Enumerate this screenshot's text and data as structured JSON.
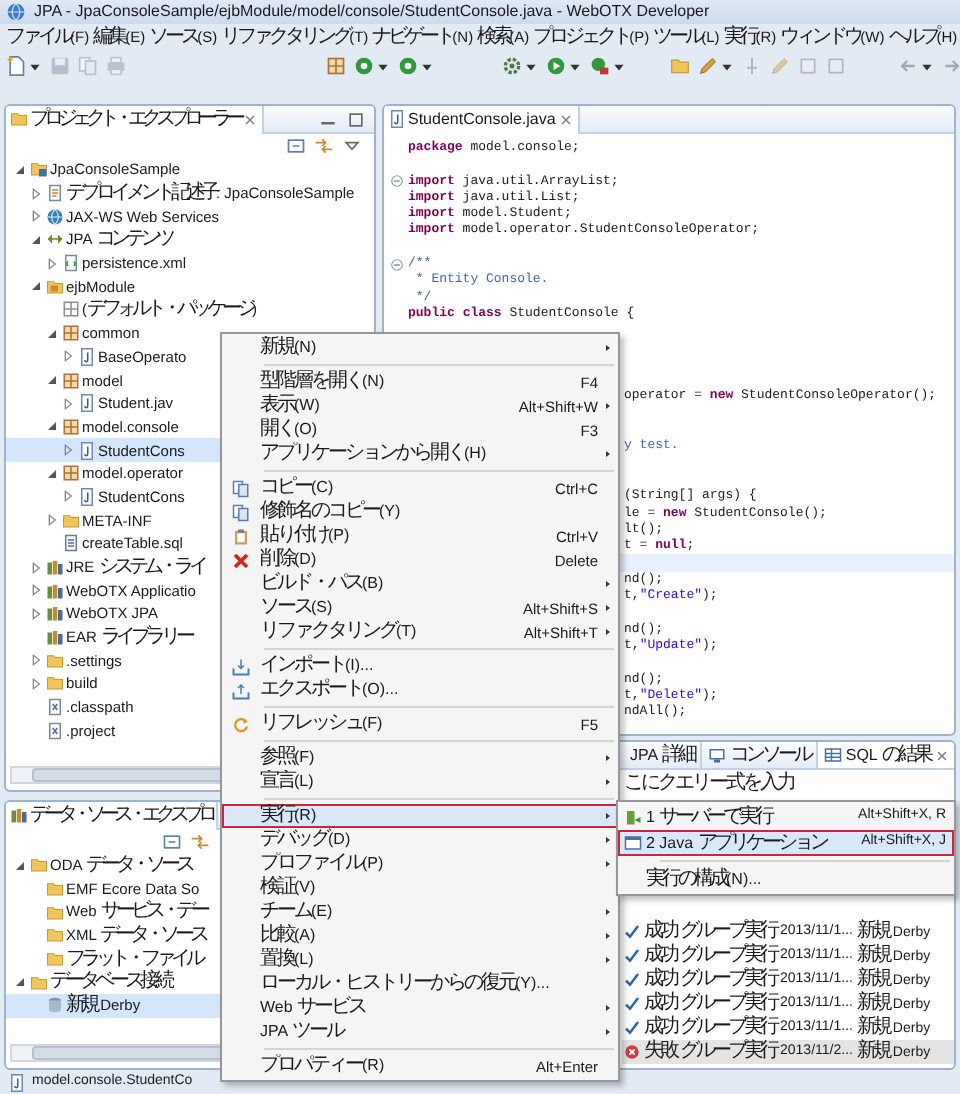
{
  "window": {
    "title": "JPA - JpaConsoleSample/ejbModule/model/console/StudentConsole.java - WebOTX Developer"
  },
  "menu_bar": [
    "ファイル(F)",
    "編集(E)",
    "ソース(S)",
    "リファクタリング(T)",
    "ナビゲート(N)",
    "検索(A)",
    "プロジェクト(P)",
    "ツール(L)",
    "実行(R)",
    "ウィンドウ(W)",
    "ヘルプ(H)"
  ],
  "project_explorer": {
    "title": "プロジェクト・エクスプローラー",
    "tree": [
      {
        "label": "JpaConsoleSample",
        "kind": "project",
        "expanded": true,
        "selected": false,
        "children": [
          {
            "label": "デプロイメント記述子: JpaConsoleSample",
            "kind": "descriptor",
            "expanded": false,
            "selected": false
          },
          {
            "label": "JAX-WS Web Services",
            "kind": "webservices",
            "expanded": false,
            "selected": false
          },
          {
            "label": "JPA コンテンツ",
            "kind": "jpa",
            "expanded": true,
            "selected": false,
            "children": [
              {
                "label": "persistence.xml",
                "kind": "xml",
                "expanded": false,
                "selected": false
              }
            ]
          },
          {
            "label": "ejbModule",
            "kind": "source-folder",
            "expanded": true,
            "selected": false,
            "children": [
              {
                "label": "(デフォルト・パッケージ)",
                "kind": "package-empty",
                "selected": false
              },
              {
                "label": "common",
                "kind": "package",
                "expanded": true,
                "selected": false,
                "children": [
                  {
                    "label": "BaseOperato",
                    "kind": "java",
                    "expanded": false,
                    "selected": false
                  }
                ]
              },
              {
                "label": "model",
                "kind": "package",
                "expanded": true,
                "selected": false,
                "children": [
                  {
                    "label": "Student.jav",
                    "kind": "java",
                    "expanded": false,
                    "selected": false
                  }
                ]
              },
              {
                "label": "model.console",
                "kind": "package",
                "expanded": true,
                "selected": false,
                "children": [
                  {
                    "label": "StudentCons",
                    "kind": "java",
                    "expanded": false,
                    "selected": true
                  }
                ]
              },
              {
                "label": "model.operator",
                "kind": "package",
                "expanded": true,
                "selected": false,
                "children": [
                  {
                    "label": "StudentCons",
                    "kind": "java",
                    "expanded": false,
                    "selected": false
                  }
                ]
              },
              {
                "label": "META-INF",
                "kind": "folder",
                "expanded": false,
                "selected": false
              },
              {
                "label": "createTable.sql",
                "kind": "sql",
                "selected": false
              }
            ]
          },
          {
            "label": "JRE システム・ライ",
            "kind": "library",
            "expanded": false,
            "selected": false
          },
          {
            "label": "WebOTX Applicatio",
            "kind": "library",
            "expanded": false,
            "selected": false
          },
          {
            "label": "WebOTX JPA",
            "kind": "library",
            "expanded": false,
            "selected": false
          },
          {
            "label": "EAR ライブラリー",
            "kind": "library",
            "selected": false
          },
          {
            "label": ".settings",
            "kind": "folder",
            "expanded": false,
            "selected": false
          },
          {
            "label": "build",
            "kind": "folder",
            "expanded": false,
            "selected": false
          },
          {
            "label": ".classpath",
            "kind": "file",
            "selected": false
          },
          {
            "label": ".project",
            "kind": "file",
            "selected": false
          }
        ]
      }
    ]
  },
  "data_source_explorer": {
    "title": "データ・ソース・エクスプロ",
    "tree": [
      {
        "label": "ODA データ・ソース",
        "kind": "folder",
        "expanded": true,
        "selected": false,
        "children": [
          {
            "label": "EMF Ecore Data So",
            "kind": "folder",
            "selected": false
          },
          {
            "label": "Web サービス・デー",
            "kind": "folder",
            "selected": false
          },
          {
            "label": "XML データ・ソース",
            "kind": "folder",
            "selected": false
          },
          {
            "label": "フラット・ファイル",
            "kind": "folder",
            "selected": false
          }
        ]
      },
      {
        "label": "データベース接続",
        "kind": "folder",
        "expanded": true,
        "selected": false,
        "children": [
          {
            "label": "新規 Derby",
            "kind": "database",
            "selected": true
          }
        ]
      }
    ]
  },
  "editor": {
    "tab": "StudentConsole.java",
    "lines": [
      {
        "kind": "code",
        "text": "package model.console;",
        "current": false
      },
      {
        "kind": "blank",
        "current": false
      },
      {
        "kind": "code",
        "text": "import java.util.ArrayList;",
        "foldable": true,
        "current": false
      },
      {
        "kind": "code",
        "text": "import java.util.List;",
        "current": false
      },
      {
        "kind": "code",
        "text": "import model.Student;",
        "current": false
      },
      {
        "kind": "code",
        "text": "import model.operator.StudentConsoleOperator;",
        "current": false
      },
      {
        "kind": "blank",
        "current": false
      },
      {
        "kind": "comment",
        "text": "/**",
        "foldable": true,
        "current": false
      },
      {
        "kind": "comment",
        "text": " * Entity Console.",
        "current": false
      },
      {
        "kind": "comment",
        "text": " */",
        "current": false
      },
      {
        "kind": "code",
        "text": "public class StudentConsole {",
        "current": false
      },
      {
        "kind": "blank",
        "current": false
      },
      {
        "kind": "blank",
        "current": false
      },
      {
        "kind": "blank",
        "current": false
      },
      {
        "kind": "blank",
        "current": false
      },
      {
        "kind": "code",
        "text": "operator = new StudentConsoleOperator();",
        "clipped": true,
        "current": false
      },
      {
        "kind": "blank",
        "current": false
      },
      {
        "kind": "blank",
        "current": false
      },
      {
        "kind": "comment",
        "text": "y test.",
        "clipped": true,
        "current": false
      },
      {
        "kind": "blank",
        "current": false
      },
      {
        "kind": "blank",
        "current": false
      },
      {
        "kind": "code",
        "text": "(String[] args) {",
        "clipped": true,
        "current": false
      },
      {
        "kind": "code",
        "text": "le = new StudentConsole();",
        "clipped": true,
        "current": false
      },
      {
        "kind": "code",
        "text": "lt();",
        "clipped": true,
        "current": false
      },
      {
        "kind": "code",
        "text": "t = null;",
        "clipped": true,
        "current": false
      },
      {
        "kind": "blank",
        "current": true
      },
      {
        "kind": "code",
        "text": "nd();",
        "clipped": true,
        "current": false
      },
      {
        "kind": "code",
        "text": "t,\"Create\");",
        "clipped": true,
        "current": false
      },
      {
        "kind": "blank",
        "current": false
      },
      {
        "kind": "code",
        "text": "nd();",
        "clipped": true,
        "current": false
      },
      {
        "kind": "code",
        "text": "t,\"Update\");",
        "clipped": true,
        "current": false
      },
      {
        "kind": "blank",
        "current": false
      },
      {
        "kind": "code",
        "text": "nd();",
        "clipped": true,
        "current": false
      },
      {
        "kind": "code",
        "text": "t,\"Delete\");",
        "clipped": true,
        "current": false
      },
      {
        "kind": "code",
        "text": "ndAll();",
        "clipped": true,
        "current": false
      }
    ]
  },
  "bottom_panel": {
    "tabs": [
      {
        "label": "JPA 詳細",
        "kind": "plain",
        "selected": false
      },
      {
        "label": "コンソール",
        "kind": "console",
        "selected": false
      },
      {
        "label": "SQL の結果",
        "kind": "sql",
        "selected": true
      }
    ],
    "query_text": "こにクエリー式を入力",
    "rows": [
      {
        "status": "成功",
        "failed": false,
        "type": "グループ実行",
        "date": "2013/11/1...",
        "connection": "新規 Derby",
        "selected": false
      },
      {
        "status": "成功",
        "failed": false,
        "type": "グループ実行",
        "date": "2013/11/1...",
        "connection": "新規 Derby",
        "selected": false
      },
      {
        "status": "成功",
        "failed": false,
        "type": "グループ実行",
        "date": "2013/11/1...",
        "connection": "新規 Derby",
        "selected": false
      },
      {
        "status": "成功",
        "failed": false,
        "type": "グループ実行",
        "date": "2013/11/1...",
        "connection": "新規 Derby",
        "selected": false
      },
      {
        "status": "成功",
        "failed": false,
        "type": "グループ実行",
        "date": "2013/11/1...",
        "connection": "新規 Derby",
        "selected": false
      },
      {
        "status": "失敗",
        "failed": true,
        "type": "グループ実行",
        "date": "2013/11/2...",
        "connection": "新規 Derby",
        "selected": true
      }
    ]
  },
  "status_bar": "model.console.StudentCo",
  "context_menu": {
    "items": [
      {
        "kind": "item",
        "label": "新規(N)",
        "submenu": true,
        "selected": false
      },
      {
        "kind": "separator"
      },
      {
        "kind": "item",
        "label": "型階層を開く(N)",
        "shortcut": "F4",
        "submenu": false,
        "selected": false
      },
      {
        "kind": "item",
        "label": "表示(W)",
        "shortcut": "Alt+Shift+W",
        "submenu": true,
        "selected": false
      },
      {
        "kind": "item",
        "label": "開く(O)",
        "shortcut": "F3",
        "submenu": false,
        "selected": false
      },
      {
        "kind": "item",
        "label": "アプリケーションから開く(H)",
        "submenu": true,
        "selected": false
      },
      {
        "kind": "separator"
      },
      {
        "kind": "copy",
        "label": "コピー(C)",
        "shortcut": "Ctrl+C",
        "submenu": false,
        "selected": false
      },
      {
        "kind": "copy",
        "label": "修飾名のコピー(Y)",
        "submenu": false,
        "selected": false
      },
      {
        "kind": "paste",
        "label": "貼り付け(P)",
        "shortcut": "Ctrl+V",
        "submenu": false,
        "selected": false
      },
      {
        "kind": "delete",
        "label": "削除(D)",
        "shortcut": "Delete",
        "submenu": false,
        "selected": false
      },
      {
        "kind": "item",
        "label": "ビルド・パス(B)",
        "submenu": true,
        "selected": false
      },
      {
        "kind": "item",
        "label": "ソース(S)",
        "shortcut": "Alt+Shift+S",
        "submenu": true,
        "selected": false
      },
      {
        "kind": "item",
        "label": "リファクタリング(T)",
        "shortcut": "Alt+Shift+T",
        "submenu": true,
        "selected": false
      },
      {
        "kind": "separator"
      },
      {
        "kind": "import",
        "label": "インポート(I)...",
        "submenu": false,
        "selected": false
      },
      {
        "kind": "export",
        "label": "エクスポート(O)...",
        "submenu": false,
        "selected": false
      },
      {
        "kind": "separator"
      },
      {
        "kind": "refresh",
        "label": "リフレッシュ(F)",
        "shortcut": "F5",
        "submenu": false,
        "selected": false
      },
      {
        "kind": "separator"
      },
      {
        "kind": "item",
        "label": "参照(F)",
        "submenu": true,
        "selected": false
      },
      {
        "kind": "item",
        "label": "宣言(L)",
        "submenu": true,
        "selected": false
      },
      {
        "kind": "separator"
      },
      {
        "kind": "item",
        "label": "実行(R)",
        "submenu": true,
        "selected": true
      },
      {
        "kind": "item",
        "label": "デバッグ(D)",
        "submenu": true,
        "selected": false
      },
      {
        "kind": "item",
        "label": "プロファイル(P)",
        "submenu": true,
        "selected": false
      },
      {
        "kind": "item",
        "label": "検証(V)",
        "submenu": false,
        "selected": false
      },
      {
        "kind": "item",
        "label": "チーム(E)",
        "submenu": true,
        "selected": false
      },
      {
        "kind": "item",
        "label": "比較(A)",
        "submenu": true,
        "selected": false
      },
      {
        "kind": "item",
        "label": "置換(L)",
        "submenu": true,
        "selected": false
      },
      {
        "kind": "item",
        "label": "ローカル・ヒストリーからの復元(Y)...",
        "submenu": false,
        "selected": false
      },
      {
        "kind": "item",
        "label": "Web サービス",
        "submenu": true,
        "selected": false
      },
      {
        "kind": "item",
        "label": "JPA ツール",
        "submenu": true,
        "selected": false
      },
      {
        "kind": "separator"
      },
      {
        "kind": "item",
        "label": "プロパティー(R)",
        "shortcut": "Alt+Enter",
        "submenu": false,
        "selected": false
      }
    ]
  },
  "submenu": {
    "items": [
      {
        "kind": "server",
        "label": "1 サーバーで実行",
        "shortcut": "Alt+Shift+X, R",
        "selected": false
      },
      {
        "kind": "java-app",
        "label": "2 Java アプリケーション",
        "shortcut": "Alt+Shift+X, J",
        "selected": true
      },
      {
        "kind": "separator"
      },
      {
        "kind": "item",
        "label": "実行の構成(N)...",
        "selected": false
      }
    ]
  }
}
